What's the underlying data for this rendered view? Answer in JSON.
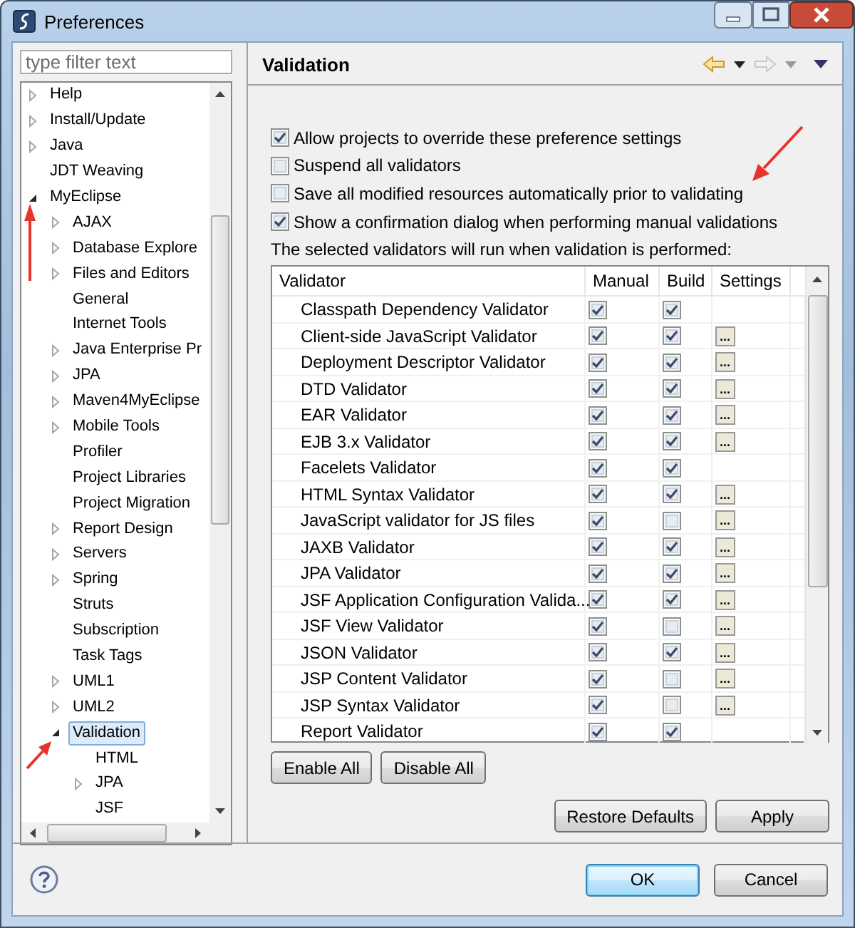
{
  "window": {
    "title": "Preferences"
  },
  "filter": {
    "placeholder": "type filter text"
  },
  "tree": [
    {
      "label": "Help",
      "expanded": false,
      "selected": false
    },
    {
      "label": "Install/Update",
      "expanded": false,
      "selected": false
    },
    {
      "label": "Java",
      "expanded": false,
      "selected": false
    },
    {
      "label": "JDT Weaving",
      "selected": false
    },
    {
      "label": "MyEclipse",
      "expanded": true,
      "selected": false,
      "children": [
        {
          "label": "AJAX",
          "expanded": false,
          "selected": false
        },
        {
          "label": "Database Explore",
          "expanded": false,
          "selected": false
        },
        {
          "label": "Files and Editors",
          "expanded": false,
          "selected": false
        },
        {
          "label": "General",
          "selected": false
        },
        {
          "label": "Internet Tools",
          "selected": false
        },
        {
          "label": "Java Enterprise Pr",
          "expanded": false,
          "selected": false
        },
        {
          "label": "JPA",
          "expanded": false,
          "selected": false
        },
        {
          "label": "Maven4MyEclipse",
          "expanded": false,
          "selected": false
        },
        {
          "label": "Mobile Tools",
          "expanded": false,
          "selected": false
        },
        {
          "label": "Profiler",
          "selected": false
        },
        {
          "label": "Project Libraries",
          "selected": false
        },
        {
          "label": "Project Migration",
          "selected": false
        },
        {
          "label": "Report Design",
          "expanded": false,
          "selected": false
        },
        {
          "label": "Servers",
          "expanded": false,
          "selected": false
        },
        {
          "label": "Spring",
          "expanded": false,
          "selected": false
        },
        {
          "label": "Struts",
          "selected": false
        },
        {
          "label": "Subscription",
          "selected": false
        },
        {
          "label": "Task Tags",
          "selected": false
        },
        {
          "label": "UML1",
          "expanded": false,
          "selected": false
        },
        {
          "label": "UML2",
          "expanded": false,
          "selected": false
        },
        {
          "label": "Validation",
          "expanded": true,
          "selected": true,
          "children": [
            {
              "label": "HTML",
              "selected": false
            },
            {
              "label": "JPA",
              "expanded": false,
              "selected": false
            },
            {
              "label": "JSF",
              "selected": false
            }
          ]
        }
      ]
    }
  ],
  "page": {
    "title": "Validation"
  },
  "options": [
    {
      "label": "Allow projects to override these preference settings",
      "checked": true
    },
    {
      "label": "Suspend all validators",
      "checked": false
    },
    {
      "label": "Save all modified resources automatically prior to validating",
      "checked": false
    },
    {
      "label": "Show a confirmation dialog when performing manual validations",
      "checked": true
    }
  ],
  "table_caption": "The selected validators will run when validation is performed:",
  "table": {
    "columns": [
      "Validator",
      "Manual",
      "Build",
      "Settings"
    ],
    "rows": [
      {
        "name": "Classpath Dependency Validator",
        "manual": true,
        "build": true
      },
      {
        "name": "Client-side JavaScript Validator",
        "manual": true,
        "build": true,
        "settings": "..."
      },
      {
        "name": "Deployment Descriptor Validator",
        "manual": true,
        "build": true,
        "settings": "..."
      },
      {
        "name": "DTD Validator",
        "manual": true,
        "build": true,
        "settings": "..."
      },
      {
        "name": "EAR Validator",
        "manual": true,
        "build": true,
        "settings": "..."
      },
      {
        "name": "EJB 3.x Validator",
        "manual": true,
        "build": true,
        "settings": "..."
      },
      {
        "name": "Facelets Validator",
        "manual": true,
        "build": true
      },
      {
        "name": "HTML Syntax Validator",
        "manual": true,
        "build": true,
        "settings": "..."
      },
      {
        "name": "JavaScript validator for JS files",
        "manual": true,
        "build": false,
        "settings": "..."
      },
      {
        "name": "JAXB Validator",
        "manual": true,
        "build": true,
        "settings": "..."
      },
      {
        "name": "JPA Validator",
        "manual": true,
        "build": true,
        "settings": "..."
      },
      {
        "name": "JSF Application Configuration Valida...",
        "manual": true,
        "build": true,
        "settings": "..."
      },
      {
        "name": "JSF View Validator",
        "manual": true,
        "build": false,
        "settings": "..."
      },
      {
        "name": "JSON Validator",
        "manual": true,
        "build": true,
        "settings": "..."
      },
      {
        "name": "JSP Content Validator",
        "manual": true,
        "build": false,
        "settings": "..."
      },
      {
        "name": "JSP Syntax Validator",
        "manual": true,
        "build": false,
        "settings": "..."
      },
      {
        "name": "Report Validator",
        "manual": true,
        "build": true
      }
    ]
  },
  "table_buttons": [
    "Enable All",
    "Disable All"
  ],
  "page_buttons": [
    "Restore Defaults",
    "Apply"
  ],
  "dialog_buttons": [
    {
      "label": "OK",
      "default": true
    },
    {
      "label": "Cancel",
      "default": false
    }
  ]
}
